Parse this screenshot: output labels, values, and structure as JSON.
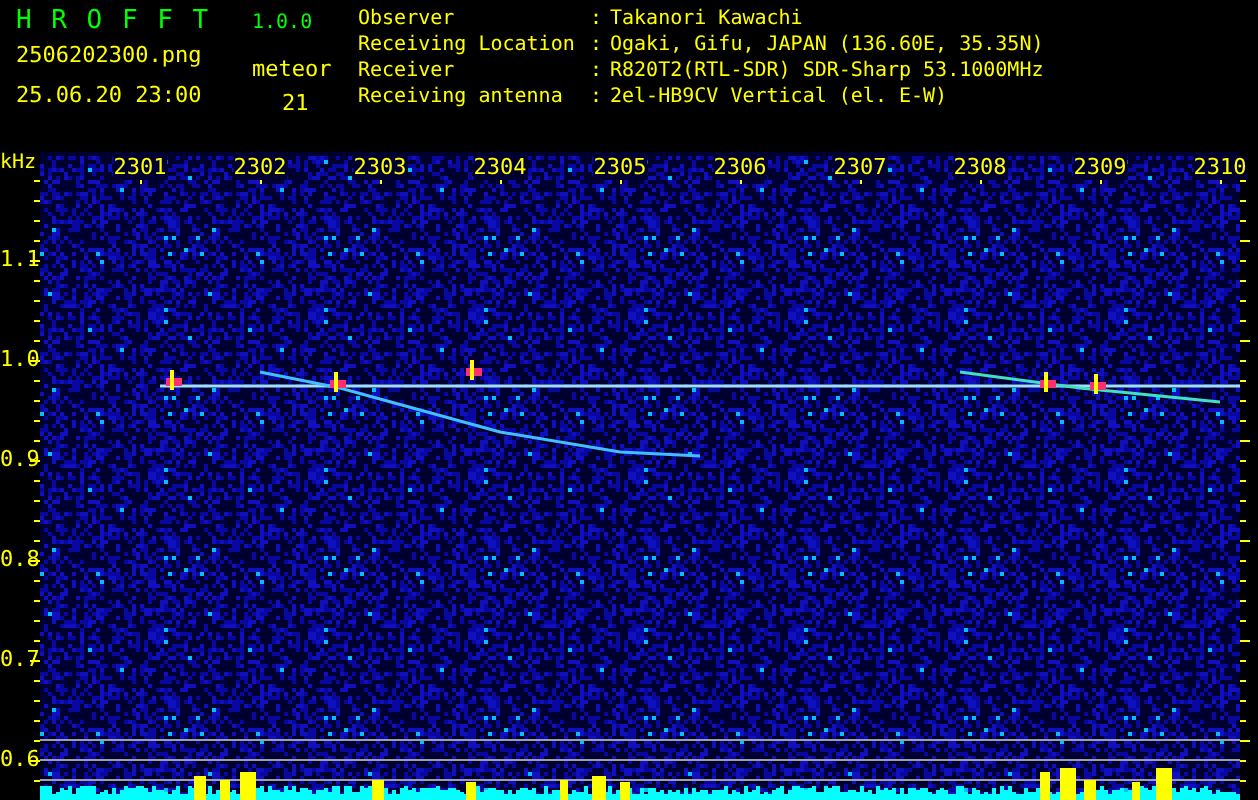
{
  "app": {
    "title": "H R O F F T",
    "version": "1.0.0"
  },
  "capture": {
    "filename": "2506202300.png",
    "datetime": "25.06.20 23:00"
  },
  "meteor": {
    "label": "meteor",
    "count": "21"
  },
  "info": [
    {
      "label": "Observer",
      "separator": ":",
      "value": "Takanori Kawachi"
    },
    {
      "label": "Receiving Location",
      "separator": ":",
      "value": "Ogaki, Gifu, JAPAN (136.60E, 35.35N)"
    },
    {
      "label": "Receiver",
      "separator": ":",
      "value": "R820T2(RTL-SDR) SDR-Sharp 53.1000MHz"
    },
    {
      "label": "Receiving antenna",
      "separator": ":",
      "value": "2el-HB9CV Vertical (el. E-W)"
    }
  ],
  "plot": {
    "y_unit": "kHz",
    "x_labels": [
      "2301",
      "2302",
      "2303",
      "2304",
      "2305",
      "2306",
      "2307",
      "2308",
      "2309",
      "2310"
    ],
    "y_labels": [
      "1.1",
      "1.0",
      "0.9",
      "0.8",
      "0.7",
      "0.6"
    ]
  }
}
